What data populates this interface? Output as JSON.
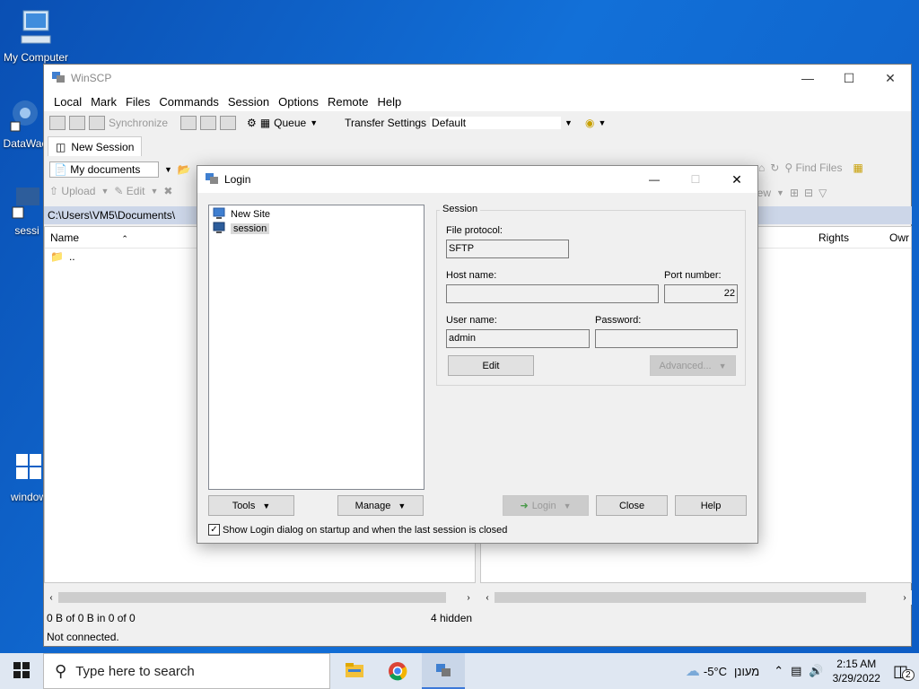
{
  "desktop": {
    "icons": [
      {
        "label": "My Computer"
      },
      {
        "label": "DataWac"
      },
      {
        "label": "sessi"
      },
      {
        "label": "window"
      }
    ]
  },
  "winscp": {
    "title": "WinSCP",
    "menu": [
      "Local",
      "Mark",
      "Files",
      "Commands",
      "Session",
      "Options",
      "Remote",
      "Help"
    ],
    "toolbar": {
      "synchronize": "Synchronize",
      "queue": "Queue",
      "transfer_settings_label": "Transfer Settings",
      "transfer_settings_value": "Default"
    },
    "tab_new_session": "New Session",
    "local": {
      "location": "My documents",
      "upload": "Upload",
      "edit": "Edit",
      "path": "C:\\Users\\VM5\\Documents\\",
      "col_name": "Name",
      "items": [
        ".."
      ]
    },
    "remote": {
      "find_files": "Find Files",
      "new": "New",
      "col_rights": "Rights",
      "col_owner": "Owr"
    },
    "status": {
      "left": "0 B of 0 B in 0 of 0",
      "hidden": "4 hidden",
      "connection": "Not connected."
    }
  },
  "login": {
    "title": "Login",
    "sites": [
      {
        "label": "New Site",
        "selected": false
      },
      {
        "label": "session",
        "selected": true
      }
    ],
    "session_group": "Session",
    "file_protocol_label": "File protocol:",
    "file_protocol_value": "SFTP",
    "host_name_label": "Host name:",
    "host_name_value": "",
    "port_label": "Port number:",
    "port_value": "22",
    "user_label": "User name:",
    "user_value": "admin",
    "password_label": "Password:",
    "password_value": "",
    "edit_button": "Edit",
    "advanced_button": "Advanced...",
    "tools_button": "Tools",
    "manage_button": "Manage",
    "login_button": "Login",
    "close_button": "Close",
    "help_button": "Help",
    "show_on_startup_label": "Show Login dialog on startup and when the last session is closed",
    "show_on_startup_checked": true
  },
  "taskbar": {
    "search_placeholder": "Type here to search",
    "weather_temp": "-5°C",
    "weather_text": "מעונן",
    "time": "2:15 AM",
    "date": "3/29/2022",
    "notifications": "2"
  }
}
